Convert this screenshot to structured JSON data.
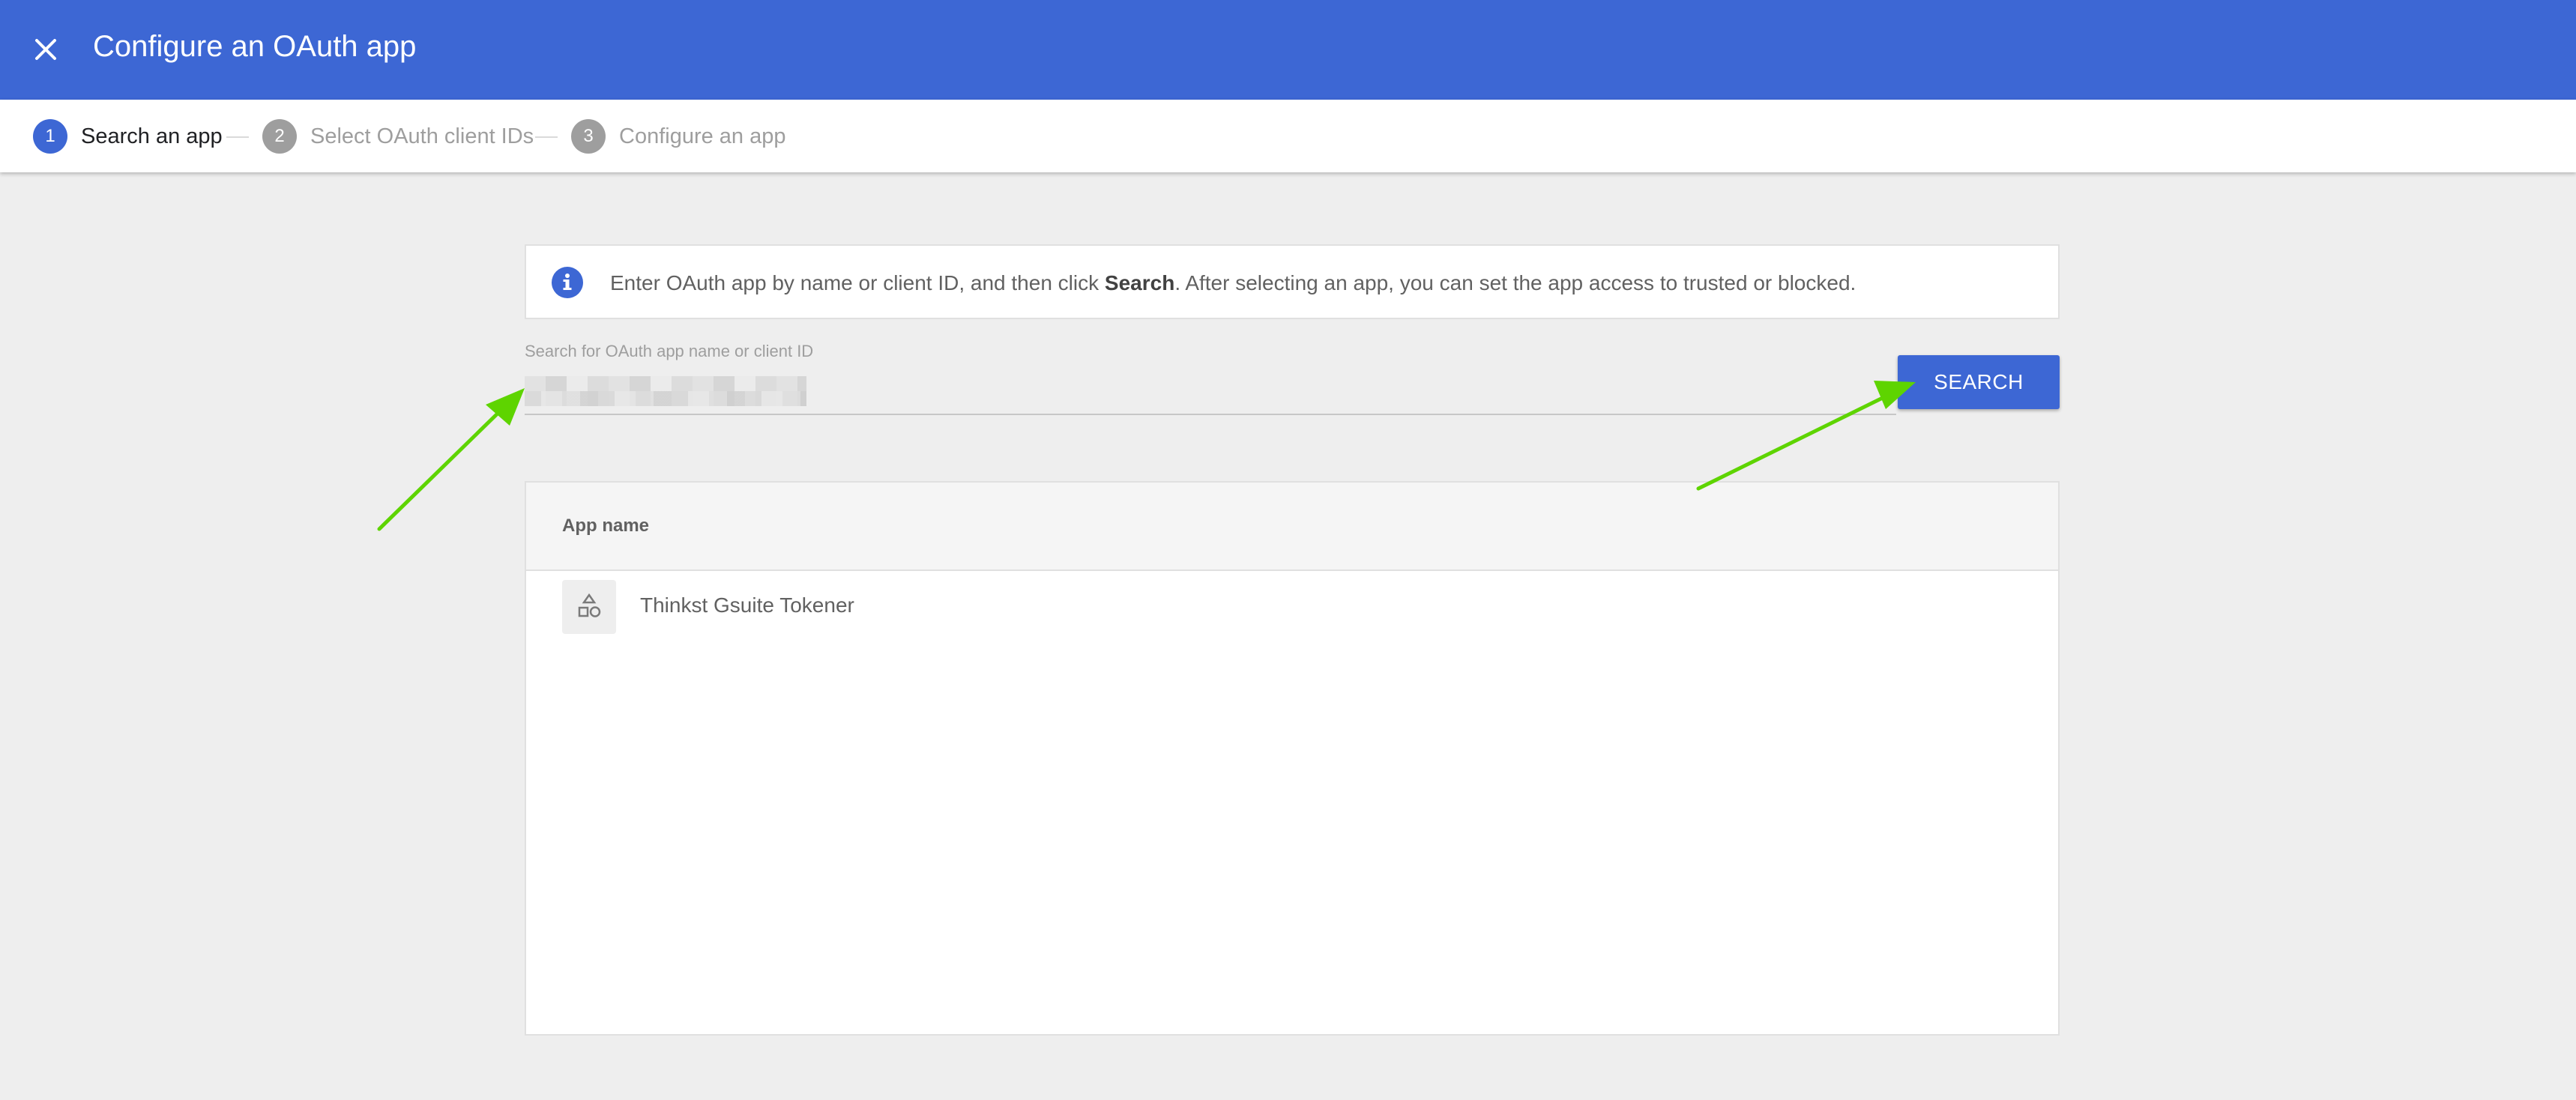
{
  "header": {
    "title": "Configure an OAuth app",
    "close_icon": "close-icon",
    "background": "#3d67d4"
  },
  "stepper": {
    "steps": [
      {
        "number": "1",
        "label": "Search an app",
        "state": "active"
      },
      {
        "number": "2",
        "label": "Select OAuth client IDs",
        "state": "inactive"
      },
      {
        "number": "3",
        "label": "Configure an app",
        "state": "inactive"
      }
    ]
  },
  "info": {
    "icon": "info-icon",
    "text_before": "Enter OAuth app by name or client ID, and then click ",
    "text_bold": "Search",
    "text_after": ". After selecting an app, you can set the app access to trusted or blocked."
  },
  "search": {
    "label": "Search for OAuth app name or client ID",
    "value": "",
    "value_redacted": true,
    "button_label": "SEARCH"
  },
  "table": {
    "columns": [
      "App name"
    ],
    "rows": [
      {
        "icon": "shapes-icon",
        "app_name": "Thinkst Gsuite Tokener"
      }
    ]
  },
  "colors": {
    "accent": "#3d67d4",
    "annotation_arrow": "#5ed400"
  }
}
